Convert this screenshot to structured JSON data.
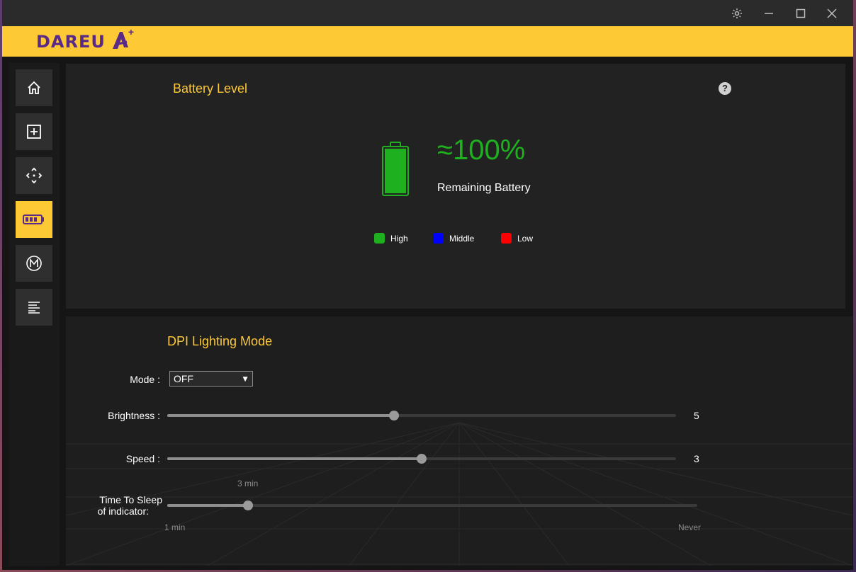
{
  "brand": {
    "logo_text": "DAREU",
    "logo_mark": "A",
    "logo_plus": "+"
  },
  "titlebar": {
    "icons": [
      "gear-icon",
      "minimize-icon",
      "maximize-icon",
      "close-icon"
    ]
  },
  "sidebar": {
    "items": [
      {
        "icon": "home-icon",
        "active": false
      },
      {
        "icon": "plus-square-icon",
        "active": false
      },
      {
        "icon": "move-arrows-icon",
        "active": false
      },
      {
        "icon": "battery-icon",
        "active": true
      },
      {
        "icon": "macro-m-icon",
        "active": false
      },
      {
        "icon": "text-lines-icon",
        "active": false
      }
    ]
  },
  "battery": {
    "title": "Battery Level",
    "help_label": "?",
    "percent_text": "≈100%",
    "level": 1.0,
    "remaining_label": "Remaining Battery",
    "legend": [
      {
        "label": "High",
        "color": "#1fb01f"
      },
      {
        "label": "Middle",
        "color": "#0000ff"
      },
      {
        "label": "Low",
        "color": "#ff0000"
      }
    ]
  },
  "dpi": {
    "title": "DPI Lighting Mode",
    "mode_label": "Mode :",
    "mode_value": "OFF",
    "mode_arrow": "▼",
    "brightness_label": "Brightness :",
    "brightness_value": "5",
    "brightness_fraction": 0.445,
    "speed_label": "Speed :",
    "speed_value": "3",
    "speed_fraction": 0.5,
    "sleep_label_line1": "Time To Sleep",
    "sleep_label_line2": "of indicator:",
    "sleep_current": "3 min",
    "sleep_fraction": 0.152,
    "sleep_min": "1 min",
    "sleep_max": "Never"
  },
  "colors": {
    "accent": "#fdc934",
    "brand_purple": "#5b2a86",
    "battery_green": "#1fb01f"
  }
}
